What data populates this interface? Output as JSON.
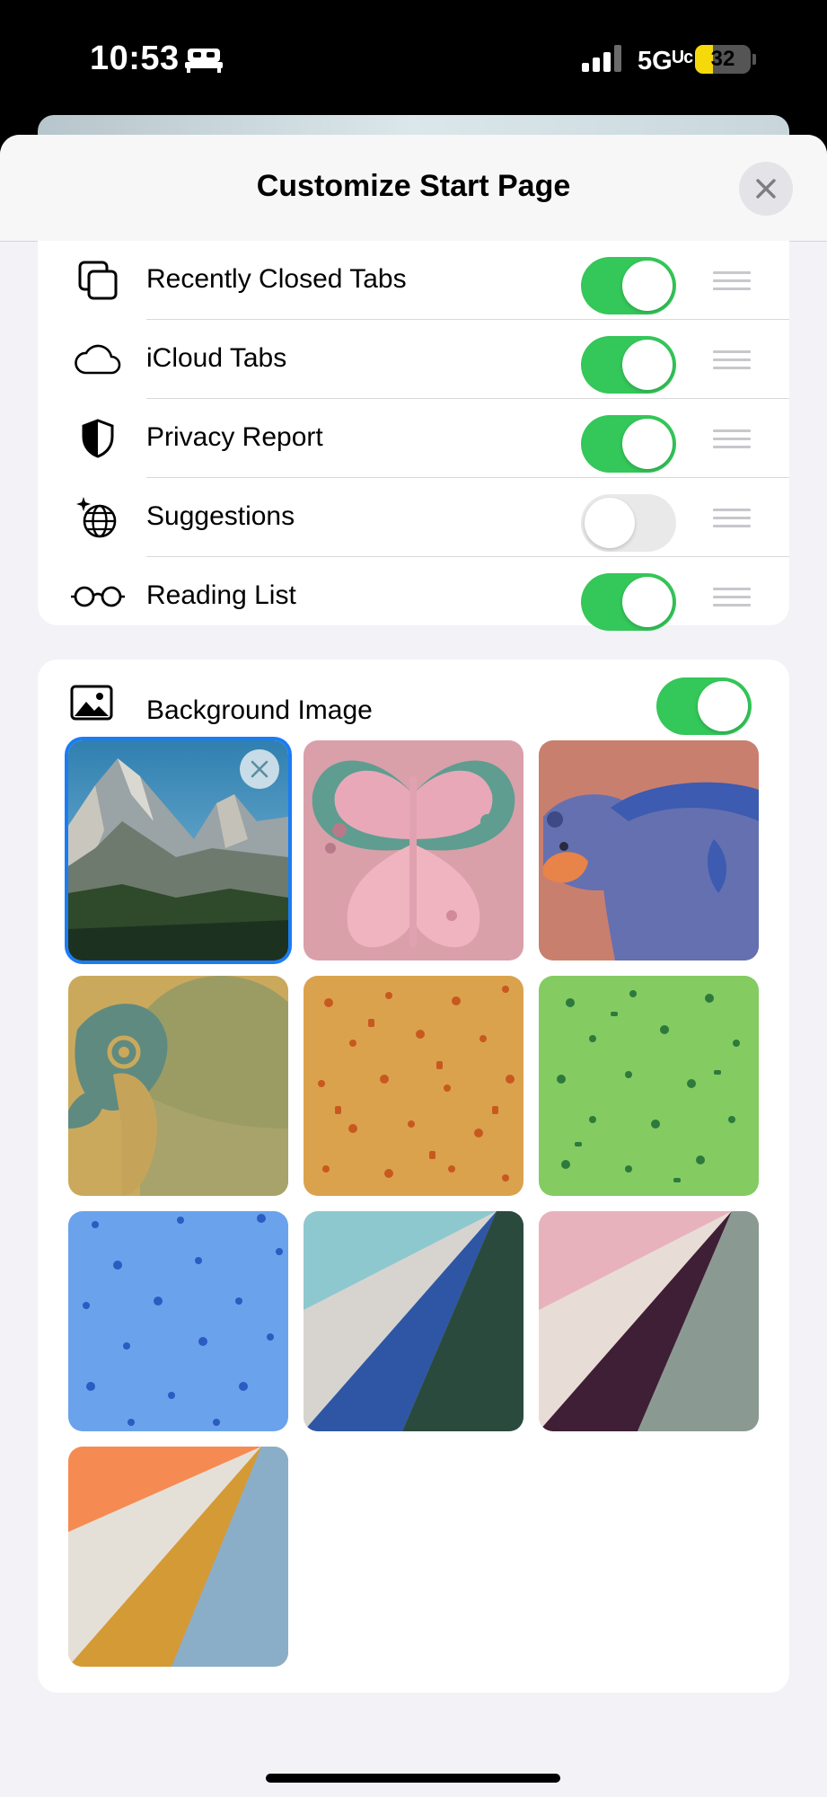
{
  "status_bar": {
    "time": "10:53",
    "network": "5Gᵁᶜ",
    "battery_level": "32",
    "battery_fraction": 0.32,
    "icons": [
      "bed-icon",
      "signal-icon",
      "battery-icon"
    ]
  },
  "sheet": {
    "title": "Customize Start Page",
    "close_icon": "close-icon"
  },
  "sections": [
    {
      "label": "Recently Closed Tabs",
      "icon": "recently-closed-tabs-icon",
      "enabled": true
    },
    {
      "label": "iCloud Tabs",
      "icon": "icloud-icon",
      "enabled": true
    },
    {
      "label": "Privacy Report",
      "icon": "privacy-shield-icon",
      "enabled": true
    },
    {
      "label": "Suggestions",
      "icon": "suggestions-globe-icon",
      "enabled": false
    },
    {
      "label": "Reading List",
      "icon": "reading-list-glasses-icon",
      "enabled": true
    }
  ],
  "background": {
    "label": "Background Image",
    "icon": "photo-icon",
    "enabled": true,
    "selected_index": 0,
    "tiles": [
      "mountain-photo",
      "butterfly",
      "bear",
      "parrot",
      "orange-pattern",
      "green-pattern",
      "blue-pattern",
      "teal-blue-green-stripes",
      "pink-plum-gray-stripes",
      "orange-gold-blue-stripes"
    ]
  },
  "colors": {
    "accent_green": "#34c759",
    "selection_blue": "#1a7cf5",
    "sheet_background": "#f2f2f7"
  }
}
